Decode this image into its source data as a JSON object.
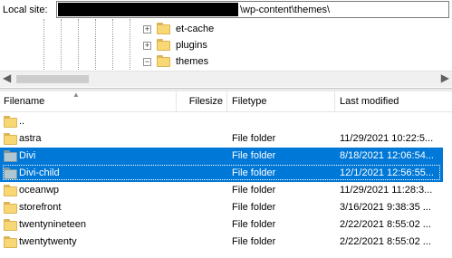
{
  "local_site": {
    "label": "Local site:",
    "path_visible": "\\wp-content\\themes\\"
  },
  "tree": {
    "items": [
      {
        "label": "et-cache",
        "expander": "+"
      },
      {
        "label": "plugins",
        "expander": "+"
      },
      {
        "label": "themes",
        "expander": "−"
      }
    ]
  },
  "file_list": {
    "columns": {
      "filename": "Filename",
      "filesize": "Filesize",
      "filetype": "Filetype",
      "last_modified": "Last modified"
    },
    "rows": [
      {
        "name": "..",
        "type": "",
        "modified": ""
      },
      {
        "name": "astra",
        "type": "File folder",
        "modified": "11/29/2021 10:22:5..."
      },
      {
        "name": "Divi",
        "type": "File folder",
        "modified": "8/18/2021 12:06:54..."
      },
      {
        "name": "Divi-child",
        "type": "File folder",
        "modified": "12/1/2021 12:56:55..."
      },
      {
        "name": "oceanwp",
        "type": "File folder",
        "modified": "11/29/2021 11:28:3..."
      },
      {
        "name": "storefront",
        "type": "File folder",
        "modified": "3/16/2021 9:38:35 ..."
      },
      {
        "name": "twentynineteen",
        "type": "File folder",
        "modified": "2/22/2021 8:55:02 ..."
      },
      {
        "name": "twentytwenty",
        "type": "File folder",
        "modified": "2/22/2021 8:55:02 ..."
      }
    ]
  },
  "colors": {
    "selection": "#0078d7",
    "folder": "#f8d775"
  },
  "icons": {
    "folder": "folder-icon",
    "scroll_left": "scroll-left-arrow-icon",
    "scroll_right": "scroll-right-arrow-icon"
  }
}
